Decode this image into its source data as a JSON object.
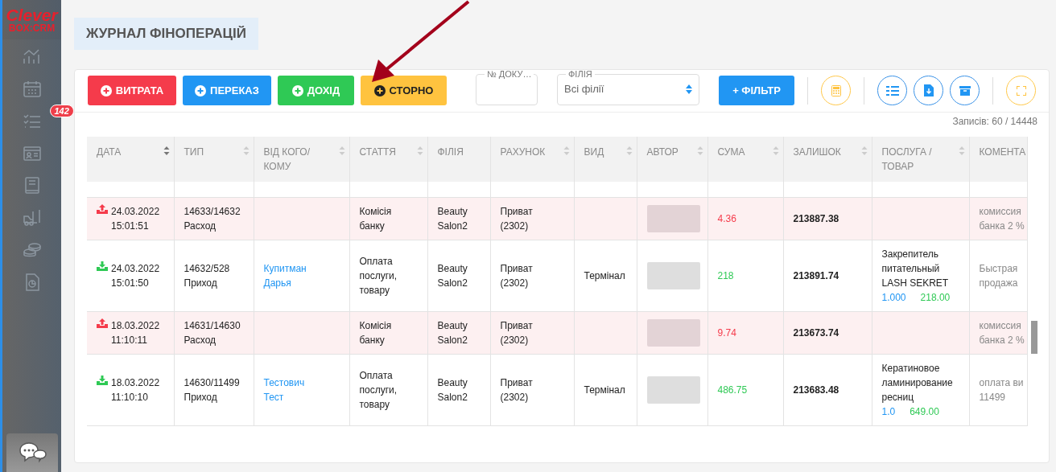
{
  "sidebar": {
    "logo": {
      "line1": "Clever",
      "line2": "BOX:CRM"
    },
    "task_badge": "142"
  },
  "page_title": "ЖУРНАЛ ФІНОПЕРАЦІЙ",
  "toolbar": {
    "buttons": [
      {
        "label": "ВИТРАТА",
        "kind": "expense"
      },
      {
        "label": "ПЕРЕКАЗ",
        "kind": "transfer"
      },
      {
        "label": "ДОХІД",
        "kind": "income"
      },
      {
        "label": "СТОРНО",
        "kind": "reversal"
      }
    ],
    "doc_field": {
      "label": "№ ДОКУ…"
    },
    "branch_select": {
      "label": "ФІЛІЯ",
      "value": "Всі філії"
    },
    "filter_button": "+ ФІЛЬТР"
  },
  "records": "Записів: 60 / 14448",
  "table": {
    "columns": [
      {
        "label": "ДАТА",
        "sortable": true
      },
      {
        "label": "ТИП",
        "sortable": true
      },
      {
        "label": "ВІД КОГО/КОМУ",
        "sortable": true
      },
      {
        "label": "СТАТТЯ",
        "sortable": true
      },
      {
        "label": "ФІЛІЯ",
        "sortable": false
      },
      {
        "label": "РАХУНОК",
        "sortable": true
      },
      {
        "label": "ВИД",
        "sortable": true
      },
      {
        "label": "АВТОР",
        "sortable": true
      },
      {
        "label": "СУМА",
        "sortable": true
      },
      {
        "label": "ЗАЛИШОК",
        "sortable": true
      },
      {
        "label": "ПОСЛУГА / ТОВАР",
        "sortable": true
      },
      {
        "label": "КОМЕНТА",
        "sortable": false
      }
    ],
    "rows": [
      {
        "kind": "expense",
        "date": "24.03.2022",
        "time": "15:01:51",
        "doc": "14633/14632",
        "type": "Расход",
        "article": "Комісія банку",
        "branch": "Beauty Salon2",
        "account": "Приват (2302)",
        "amount": "4.36",
        "balance": "213887.38",
        "comment": "комиссия банка 2 %"
      },
      {
        "kind": "income",
        "date": "24.03.2022",
        "time": "15:01:50",
        "doc": "14632/528",
        "type": "Приход",
        "counterparty": "Купитман Дарья",
        "article": "Оплата послуги, товару",
        "branch": "Beauty Salon2",
        "account": "Приват (2302)",
        "method": "Термінал",
        "amount": "218",
        "balance": "213891.74",
        "item": {
          "name": "Закрепитель питательный LASH SEKRET",
          "qty": "1.000",
          "price": "218.00"
        },
        "comment": "Быстрая продажа"
      },
      {
        "kind": "expense",
        "date": "18.03.2022",
        "time": "11:10:11",
        "doc": "14631/14630",
        "type": "Расход",
        "article": "Комісія банку",
        "branch": "Beauty Salon2",
        "account": "Приват (2302)",
        "amount": "9.74",
        "balance": "213673.74",
        "comment": "комиссия банка 2 %"
      },
      {
        "kind": "income",
        "date": "18.03.2022",
        "time": "11:10:10",
        "doc": "14630/11499",
        "type": "Приход",
        "counterparty": "Тестович Тест",
        "article": "Оплата послуги, товару",
        "branch": "Beauty Salon2",
        "account": "Приват (2302)",
        "method": "Термінал",
        "amount": "486.75",
        "balance": "213683.48",
        "item": {
          "name": "Кератиновое ламинирование ресниц",
          "qty": "1.0",
          "price": "649.00"
        },
        "comment": "оплата ви 11499"
      }
    ]
  }
}
